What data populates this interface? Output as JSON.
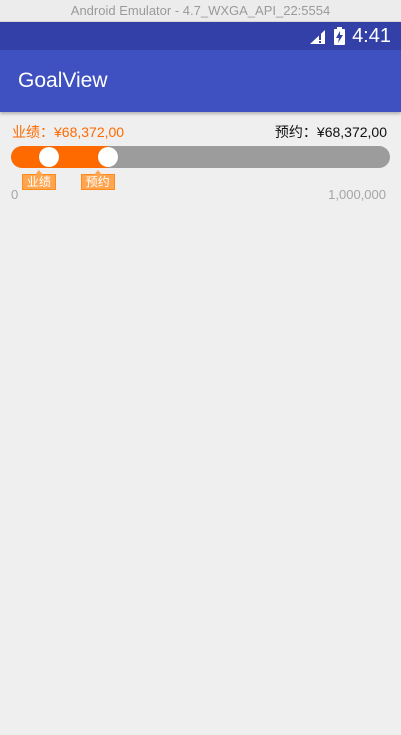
{
  "window": {
    "title": "Android Emulator - 4.7_WXGA_API_22:5554"
  },
  "status_bar": {
    "time": "4:41",
    "background": "#3240a8"
  },
  "app_bar": {
    "title": "GoalView",
    "background": "#3f51c1"
  },
  "goal_view": {
    "achieved_label": "业绩：¥68,372,00",
    "booked_label": "预约：¥68,372,00",
    "achieved_tag": "业绩",
    "booked_tag": "预约",
    "scale_min": "0",
    "scale_max": "1,000,000",
    "achieved_fraction": 0.1,
    "booked_fraction": 0.255,
    "accent_color": "#ff6a00",
    "track_color": "#9c9c9c"
  }
}
